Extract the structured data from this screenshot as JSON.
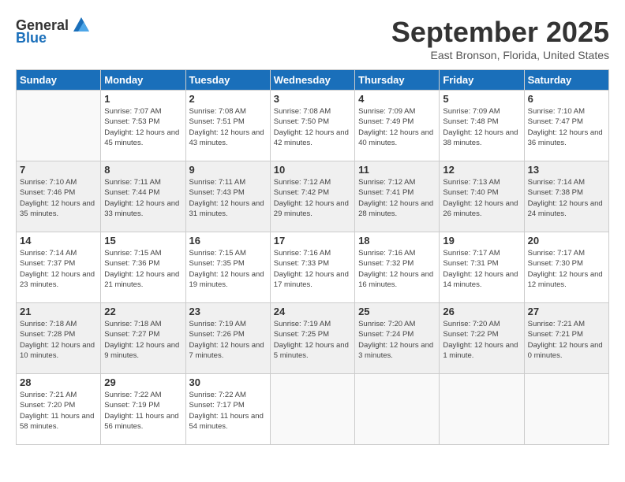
{
  "logo": {
    "text1": "General",
    "text2": "Blue"
  },
  "title": {
    "month": "September 2025",
    "location": "East Bronson, Florida, United States"
  },
  "weekdays": [
    "Sunday",
    "Monday",
    "Tuesday",
    "Wednesday",
    "Thursday",
    "Friday",
    "Saturday"
  ],
  "weeks": [
    [
      {
        "day": "",
        "sunrise": "",
        "sunset": "",
        "daylight": ""
      },
      {
        "day": "1",
        "sunrise": "Sunrise: 7:07 AM",
        "sunset": "Sunset: 7:53 PM",
        "daylight": "Daylight: 12 hours and 45 minutes."
      },
      {
        "day": "2",
        "sunrise": "Sunrise: 7:08 AM",
        "sunset": "Sunset: 7:51 PM",
        "daylight": "Daylight: 12 hours and 43 minutes."
      },
      {
        "day": "3",
        "sunrise": "Sunrise: 7:08 AM",
        "sunset": "Sunset: 7:50 PM",
        "daylight": "Daylight: 12 hours and 42 minutes."
      },
      {
        "day": "4",
        "sunrise": "Sunrise: 7:09 AM",
        "sunset": "Sunset: 7:49 PM",
        "daylight": "Daylight: 12 hours and 40 minutes."
      },
      {
        "day": "5",
        "sunrise": "Sunrise: 7:09 AM",
        "sunset": "Sunset: 7:48 PM",
        "daylight": "Daylight: 12 hours and 38 minutes."
      },
      {
        "day": "6",
        "sunrise": "Sunrise: 7:10 AM",
        "sunset": "Sunset: 7:47 PM",
        "daylight": "Daylight: 12 hours and 36 minutes."
      }
    ],
    [
      {
        "day": "7",
        "sunrise": "Sunrise: 7:10 AM",
        "sunset": "Sunset: 7:46 PM",
        "daylight": "Daylight: 12 hours and 35 minutes."
      },
      {
        "day": "8",
        "sunrise": "Sunrise: 7:11 AM",
        "sunset": "Sunset: 7:44 PM",
        "daylight": "Daylight: 12 hours and 33 minutes."
      },
      {
        "day": "9",
        "sunrise": "Sunrise: 7:11 AM",
        "sunset": "Sunset: 7:43 PM",
        "daylight": "Daylight: 12 hours and 31 minutes."
      },
      {
        "day": "10",
        "sunrise": "Sunrise: 7:12 AM",
        "sunset": "Sunset: 7:42 PM",
        "daylight": "Daylight: 12 hours and 29 minutes."
      },
      {
        "day": "11",
        "sunrise": "Sunrise: 7:12 AM",
        "sunset": "Sunset: 7:41 PM",
        "daylight": "Daylight: 12 hours and 28 minutes."
      },
      {
        "day": "12",
        "sunrise": "Sunrise: 7:13 AM",
        "sunset": "Sunset: 7:40 PM",
        "daylight": "Daylight: 12 hours and 26 minutes."
      },
      {
        "day": "13",
        "sunrise": "Sunrise: 7:14 AM",
        "sunset": "Sunset: 7:38 PM",
        "daylight": "Daylight: 12 hours and 24 minutes."
      }
    ],
    [
      {
        "day": "14",
        "sunrise": "Sunrise: 7:14 AM",
        "sunset": "Sunset: 7:37 PM",
        "daylight": "Daylight: 12 hours and 23 minutes."
      },
      {
        "day": "15",
        "sunrise": "Sunrise: 7:15 AM",
        "sunset": "Sunset: 7:36 PM",
        "daylight": "Daylight: 12 hours and 21 minutes."
      },
      {
        "day": "16",
        "sunrise": "Sunrise: 7:15 AM",
        "sunset": "Sunset: 7:35 PM",
        "daylight": "Daylight: 12 hours and 19 minutes."
      },
      {
        "day": "17",
        "sunrise": "Sunrise: 7:16 AM",
        "sunset": "Sunset: 7:33 PM",
        "daylight": "Daylight: 12 hours and 17 minutes."
      },
      {
        "day": "18",
        "sunrise": "Sunrise: 7:16 AM",
        "sunset": "Sunset: 7:32 PM",
        "daylight": "Daylight: 12 hours and 16 minutes."
      },
      {
        "day": "19",
        "sunrise": "Sunrise: 7:17 AM",
        "sunset": "Sunset: 7:31 PM",
        "daylight": "Daylight: 12 hours and 14 minutes."
      },
      {
        "day": "20",
        "sunrise": "Sunrise: 7:17 AM",
        "sunset": "Sunset: 7:30 PM",
        "daylight": "Daylight: 12 hours and 12 minutes."
      }
    ],
    [
      {
        "day": "21",
        "sunrise": "Sunrise: 7:18 AM",
        "sunset": "Sunset: 7:28 PM",
        "daylight": "Daylight: 12 hours and 10 minutes."
      },
      {
        "day": "22",
        "sunrise": "Sunrise: 7:18 AM",
        "sunset": "Sunset: 7:27 PM",
        "daylight": "Daylight: 12 hours and 9 minutes."
      },
      {
        "day": "23",
        "sunrise": "Sunrise: 7:19 AM",
        "sunset": "Sunset: 7:26 PM",
        "daylight": "Daylight: 12 hours and 7 minutes."
      },
      {
        "day": "24",
        "sunrise": "Sunrise: 7:19 AM",
        "sunset": "Sunset: 7:25 PM",
        "daylight": "Daylight: 12 hours and 5 minutes."
      },
      {
        "day": "25",
        "sunrise": "Sunrise: 7:20 AM",
        "sunset": "Sunset: 7:24 PM",
        "daylight": "Daylight: 12 hours and 3 minutes."
      },
      {
        "day": "26",
        "sunrise": "Sunrise: 7:20 AM",
        "sunset": "Sunset: 7:22 PM",
        "daylight": "Daylight: 12 hours and 1 minute."
      },
      {
        "day": "27",
        "sunrise": "Sunrise: 7:21 AM",
        "sunset": "Sunset: 7:21 PM",
        "daylight": "Daylight: 12 hours and 0 minutes."
      }
    ],
    [
      {
        "day": "28",
        "sunrise": "Sunrise: 7:21 AM",
        "sunset": "Sunset: 7:20 PM",
        "daylight": "Daylight: 11 hours and 58 minutes."
      },
      {
        "day": "29",
        "sunrise": "Sunrise: 7:22 AM",
        "sunset": "Sunset: 7:19 PM",
        "daylight": "Daylight: 11 hours and 56 minutes."
      },
      {
        "day": "30",
        "sunrise": "Sunrise: 7:22 AM",
        "sunset": "Sunset: 7:17 PM",
        "daylight": "Daylight: 11 hours and 54 minutes."
      },
      {
        "day": "",
        "sunrise": "",
        "sunset": "",
        "daylight": ""
      },
      {
        "day": "",
        "sunrise": "",
        "sunset": "",
        "daylight": ""
      },
      {
        "day": "",
        "sunrise": "",
        "sunset": "",
        "daylight": ""
      },
      {
        "day": "",
        "sunrise": "",
        "sunset": "",
        "daylight": ""
      }
    ]
  ]
}
